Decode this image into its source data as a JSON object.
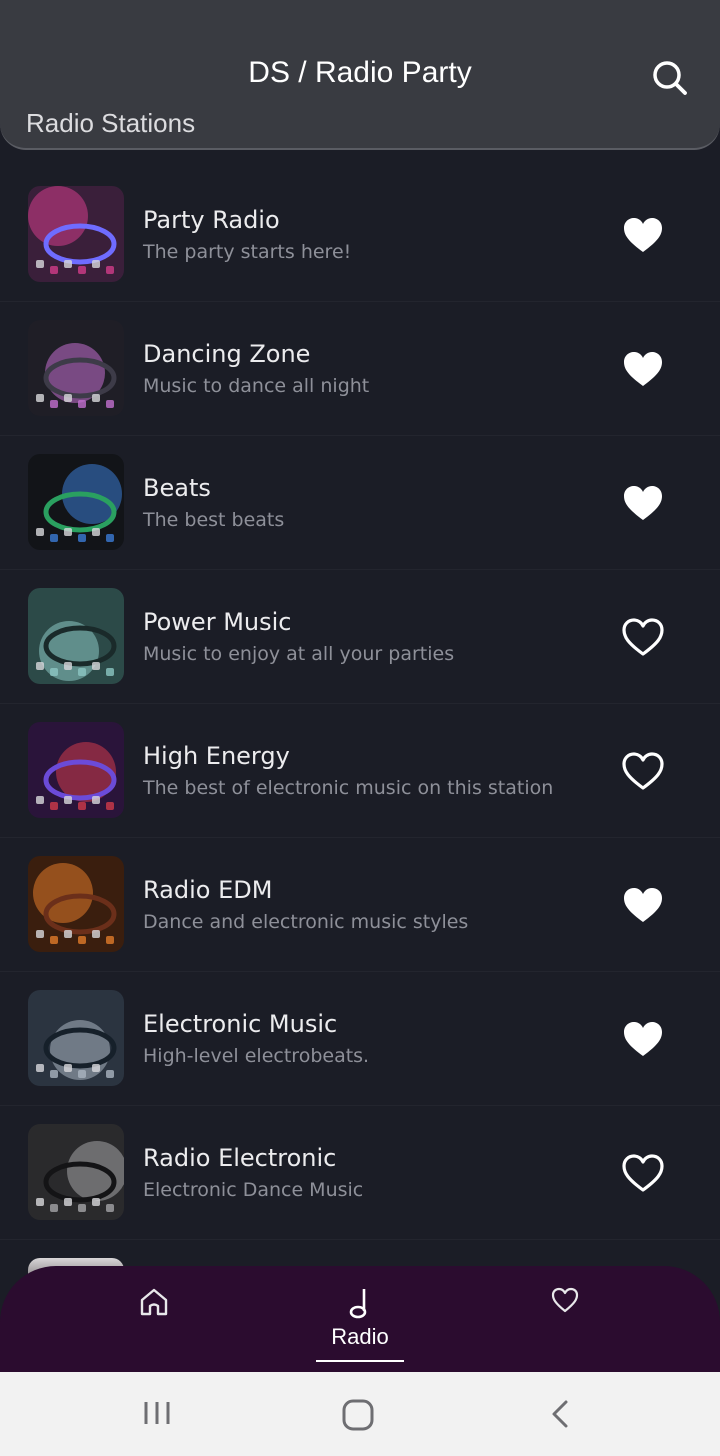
{
  "header": {
    "title": "DS / Radio Party",
    "subtitle": "Radio Stations",
    "search_icon": "search-icon"
  },
  "stations": [
    {
      "name": "Party Radio",
      "description": "The party starts here!",
      "favorite": true,
      "thumb_colors": [
        "#3a1f3a",
        "#d13c8a",
        "#6f6cff"
      ]
    },
    {
      "name": "Dancing Zone",
      "description": "Music to dance all night",
      "favorite": true,
      "thumb_colors": [
        "#1f1e26",
        "#c26fd0",
        "#3d3b48"
      ]
    },
    {
      "name": "Beats",
      "description": "The best beats",
      "favorite": true,
      "thumb_colors": [
        "#121418",
        "#3b7bd6",
        "#2aa060"
      ]
    },
    {
      "name": "Power Music",
      "description": "Music to enjoy at all your parties",
      "favorite": false,
      "thumb_colors": [
        "#2c4a48",
        "#8cc6c2",
        "#1a2a2a"
      ]
    },
    {
      "name": "High Energy",
      "description": "The best of electronic music on this station",
      "favorite": false,
      "thumb_colors": [
        "#2a143a",
        "#d03a4a",
        "#6b4bd8"
      ]
    },
    {
      "name": "Radio EDM",
      "description": "Dance and electronic music styles",
      "favorite": true,
      "thumb_colors": [
        "#3a1e0e",
        "#e07a2a",
        "#6b2f1a"
      ]
    },
    {
      "name": "Electronic Music",
      "description": "High-level electrobeats.",
      "favorite": true,
      "thumb_colors": [
        "#2b3440",
        "#aab4bf",
        "#16202a"
      ]
    },
    {
      "name": "Radio Electronic",
      "description": "Electronic Dance Music",
      "favorite": false,
      "thumb_colors": [
        "#2a2a2c",
        "#a4a4a8",
        "#141416"
      ]
    }
  ],
  "bottom_nav": {
    "home_icon": "home-icon",
    "radio_label": "Radio",
    "radio_icon": "music-note-icon",
    "favorites_icon": "heart-icon",
    "background": "#2b0c2f"
  },
  "system_nav": {
    "recent_icon": "recent-apps-icon",
    "home_icon": "home-circle-icon",
    "back_icon": "back-icon"
  }
}
